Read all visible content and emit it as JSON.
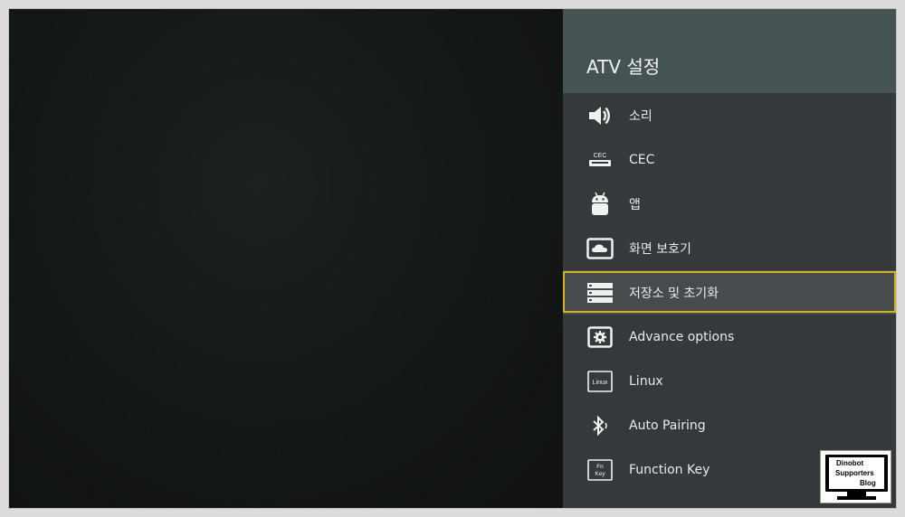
{
  "panel": {
    "title": "ATV 설정"
  },
  "menu": {
    "items": [
      {
        "label": "소리",
        "icon": "speaker-icon"
      },
      {
        "label": "CEC",
        "icon": "cec-icon"
      },
      {
        "label": "앱",
        "icon": "android-icon"
      },
      {
        "label": "화면 보호기",
        "icon": "screensaver-icon"
      },
      {
        "label": "저장소 및 초기화",
        "icon": "storage-icon",
        "selected": true
      },
      {
        "label": "Advance options",
        "icon": "settings-icon"
      },
      {
        "label": "Linux",
        "icon": "linux-icon"
      },
      {
        "label": "Auto Pairing",
        "icon": "bluetooth-icon"
      },
      {
        "label": "Function Key",
        "icon": "fn-key-icon"
      }
    ]
  },
  "icon_texts": {
    "cec": "CEC",
    "linux": "Linux",
    "fn_top": "Fn",
    "fn_bottom": "Key"
  },
  "watermark": {
    "line1": "Dinobot",
    "line2": "Supporters",
    "line3": "Blog"
  },
  "colors": {
    "panel_bg": "#343a3b",
    "header_bg": "#455354",
    "focus_border": "#d8b41c",
    "text": "#e7ebeb"
  }
}
